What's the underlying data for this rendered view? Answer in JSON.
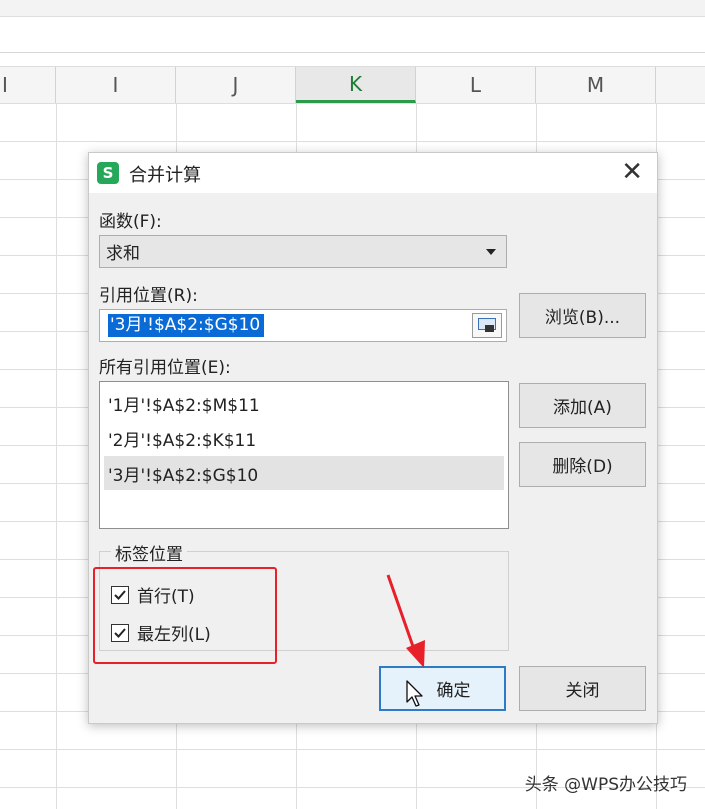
{
  "sheet": {
    "columns": [
      {
        "label": "I",
        "active": false
      },
      {
        "label": "I",
        "active": false
      },
      {
        "label": "J",
        "active": false
      },
      {
        "label": "K",
        "active": true
      },
      {
        "label": "L",
        "active": false
      },
      {
        "label": "M",
        "active": false
      }
    ]
  },
  "dialog": {
    "title": "合并计算",
    "app_icon_letter": "S",
    "close_glyph": "✕",
    "function_label": "函数(F):",
    "function_value": "求和",
    "reference_label": "引用位置(R):",
    "reference_value": "'3月'!$A$2:$G$10",
    "browse_button": "浏览(B)...",
    "all_references_label": "所有引用位置(E):",
    "all_references": [
      {
        "text": "'1月'!$A$2:$M$11",
        "selected": false
      },
      {
        "text": "'2月'!$A$2:$K$11",
        "selected": false
      },
      {
        "text": "'3月'!$A$2:$G$10",
        "selected": true
      }
    ],
    "add_button": "添加(A)",
    "delete_button": "删除(D)",
    "label_position_group": "标签位置",
    "top_row_label": "首行(T)",
    "top_row_checked": true,
    "left_column_label": "最左列(L)",
    "left_column_checked": true,
    "ok_button": "确定",
    "close_button": "关闭"
  },
  "annotation": {
    "highlight_color": "#e8202a"
  },
  "watermark": "头条 @WPS办公技巧",
  "icons": {
    "app": "wps-spreadsheet-icon",
    "close": "close-icon",
    "dropdown": "chevron-down-icon",
    "collapse": "collapse-dialog-icon",
    "check": "checkmark-icon",
    "cursor": "mouse-pointer-icon"
  }
}
